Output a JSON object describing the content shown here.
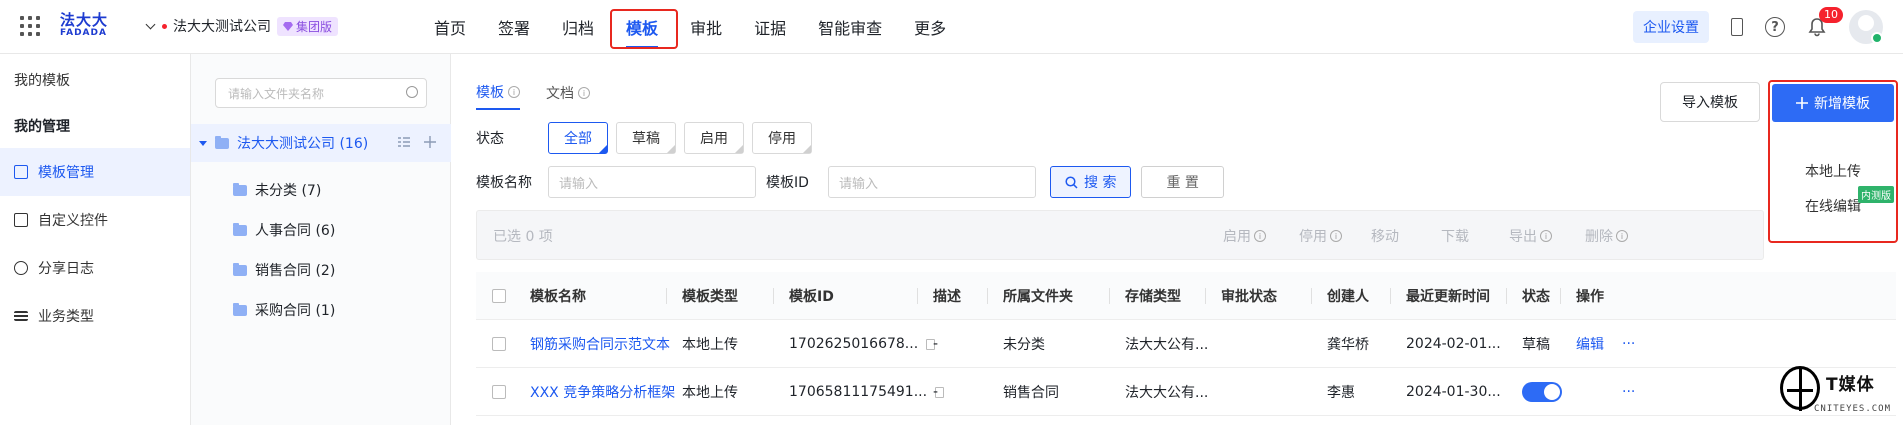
{
  "header": {
    "logo_cn": "法大大",
    "logo_en": "FADADA",
    "company": "法大大测试公司",
    "company_badge": "集团版",
    "nav": [
      "首页",
      "签署",
      "归档",
      "模板",
      "审批",
      "证据",
      "智能审查",
      "更多"
    ],
    "active_nav": "模板",
    "enterprise_settings": "企业设置",
    "help": "?",
    "notification_count": "10"
  },
  "leftnav": {
    "my_templates": "我的模板",
    "my_management": "我的管理",
    "items": [
      "模板管理",
      "自定义控件",
      "分享日志",
      "业务类型"
    ],
    "active": "模板管理"
  },
  "folders": {
    "search_placeholder": "请输入文件夹名称",
    "root": "法大大测试公司 (16)",
    "children": [
      "未分类 (7)",
      "人事合同 (6)",
      "销售合同 (2)",
      "采购合同 (1)"
    ]
  },
  "main": {
    "tabs": [
      "模板",
      "文档"
    ],
    "status_label": "状态",
    "status_options": [
      "全部",
      "草稿",
      "启用",
      "停用"
    ],
    "name_label": "模板名称",
    "name_placeholder": "请输入",
    "id_label": "模板ID",
    "id_placeholder": "请输入",
    "search_button": "搜 索",
    "reset_button": "重 置",
    "import_button": "导入模板",
    "new_button": "新增模板",
    "new_menu": [
      "本地上传",
      "在线编辑"
    ],
    "beta_badge": "内测版",
    "bulk_selected": "已选  0  项",
    "bulk_actions": [
      "启用",
      "停用",
      "移动",
      "下载",
      "导出",
      "删除"
    ]
  },
  "table": {
    "columns": [
      "模板名称",
      "模板类型",
      "模板ID",
      "描述",
      "所属文件夹",
      "存储类型",
      "审批状态",
      "创建人",
      "最近更新时间",
      "状态",
      "操作"
    ],
    "rows": [
      {
        "name": "钢筋采购合同示范文本",
        "type": "本地上传",
        "id": "1702625016678...",
        "desc": "-",
        "folder": "未分类",
        "storage": "法大大公有...",
        "approval": "",
        "creator": "龚华桥",
        "updated": "2024-02-01...",
        "status": "草稿",
        "op": "编辑",
        "more": "···"
      },
      {
        "name": "XXX 竞争策略分析框架",
        "type": "本地上传",
        "id": "17065811175491...",
        "desc": "-",
        "folder": "销售合同",
        "storage": "法大大公有...",
        "approval": "",
        "creator": "李惠",
        "updated": "2024-01-30...",
        "status": "",
        "op": "",
        "more": "···"
      }
    ]
  },
  "watermark": {
    "cn": "T媒体",
    "en": "CNITEYES.COM"
  },
  "colors": {
    "primary": "#2d6bf5",
    "highlight": "#e8281f",
    "beta": "#2fb36b"
  }
}
